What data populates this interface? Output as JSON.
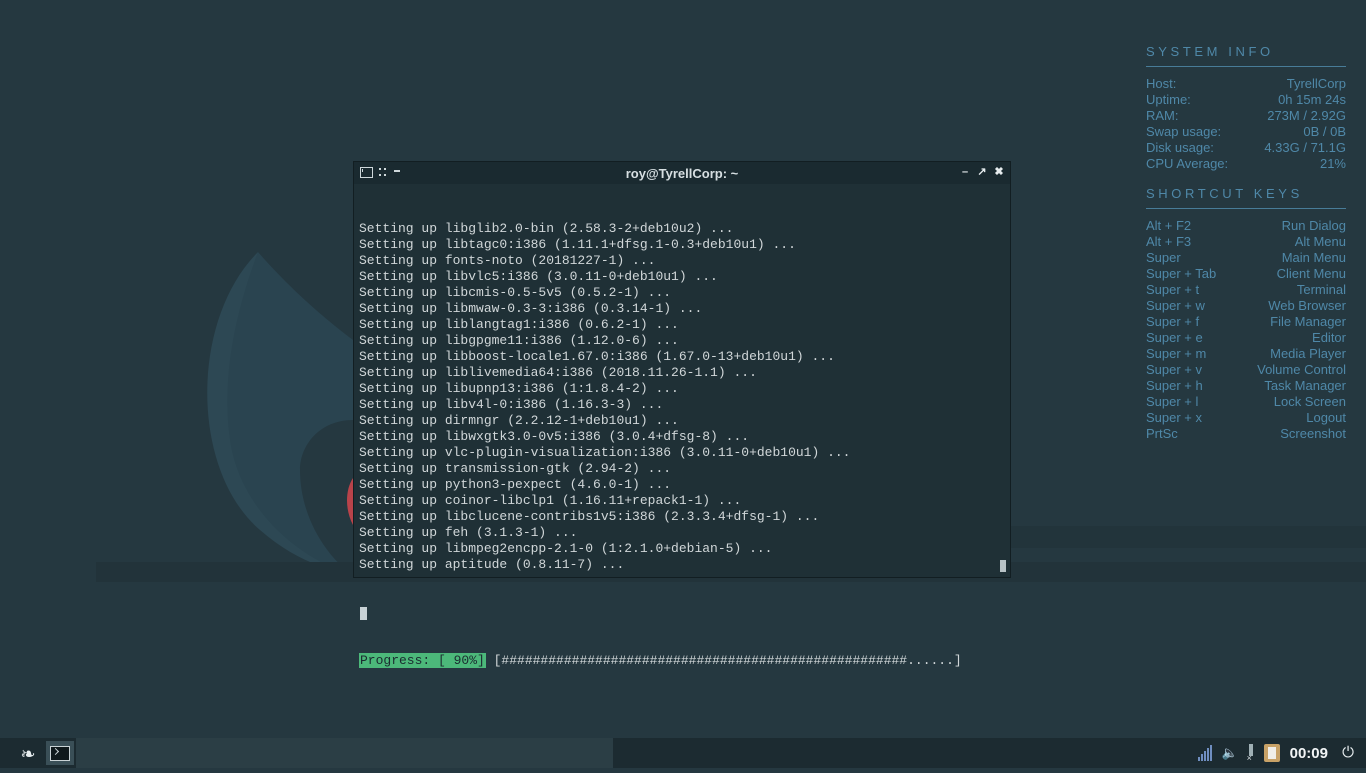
{
  "conky": {
    "system_title": "SYSTEM INFO",
    "system_rows": [
      {
        "label": "Host:",
        "value": "TyrellCorp"
      },
      {
        "label": "Uptime:",
        "value": "0h 15m 24s"
      },
      {
        "label": "RAM:",
        "value": "273M / 2.92G"
      },
      {
        "label": "Swap usage:",
        "value": "0B / 0B"
      },
      {
        "label": "Disk usage:",
        "value": "4.33G / 71.1G"
      },
      {
        "label": "CPU Average:",
        "value": "21%"
      }
    ],
    "shortcut_title": "SHORTCUT KEYS",
    "shortcut_rows": [
      {
        "label": "Alt + F2",
        "value": "Run Dialog"
      },
      {
        "label": "Alt + F3",
        "value": "Alt Menu"
      },
      {
        "label": "Super",
        "value": "Main Menu"
      },
      {
        "label": "Super + Tab",
        "value": "Client Menu"
      },
      {
        "label": "Super + t",
        "value": "Terminal"
      },
      {
        "label": "Super + w",
        "value": "Web Browser"
      },
      {
        "label": "Super + f",
        "value": "File Manager"
      },
      {
        "label": "Super + e",
        "value": "Editor"
      },
      {
        "label": "Super + m",
        "value": "Media Player"
      },
      {
        "label": "Super + v",
        "value": "Volume Control"
      },
      {
        "label": "Super + h",
        "value": "Task Manager"
      },
      {
        "label": "Super + l",
        "value": "Lock Screen"
      },
      {
        "label": "Super + x",
        "value": "Logout"
      },
      {
        "label": "PrtSc",
        "value": "Screenshot"
      }
    ]
  },
  "terminal": {
    "title": "roy@TyrellCorp: ~",
    "lines": [
      "Setting up libglib2.0-bin (2.58.3-2+deb10u2) ...",
      "Setting up libtagc0:i386 (1.11.1+dfsg.1-0.3+deb10u1) ...",
      "Setting up fonts-noto (20181227-1) ...",
      "Setting up libvlc5:i386 (3.0.11-0+deb10u1) ...",
      "Setting up libcmis-0.5-5v5 (0.5.2-1) ...",
      "Setting up libmwaw-0.3-3:i386 (0.3.14-1) ...",
      "Setting up liblangtag1:i386 (0.6.2-1) ...",
      "Setting up libgpgme11:i386 (1.12.0-6) ...",
      "Setting up libboost-locale1.67.0:i386 (1.67.0-13+deb10u1) ...",
      "Setting up liblivemedia64:i386 (2018.11.26-1.1) ...",
      "Setting up libupnp13:i386 (1:1.8.4-2) ...",
      "Setting up libv4l-0:i386 (1.16.3-3) ...",
      "Setting up dirmngr (2.2.12-1+deb10u1) ...",
      "Setting up libwxgtk3.0-0v5:i386 (3.0.4+dfsg-8) ...",
      "Setting up vlc-plugin-visualization:i386 (3.0.11-0+deb10u1) ...",
      "Setting up transmission-gtk (2.94-2) ...",
      "Setting up python3-pexpect (4.6.0-1) ...",
      "Setting up coinor-libclp1 (1.16.11+repack1-1) ...",
      "Setting up libclucene-contribs1v5:i386 (2.3.3.4+dfsg-1) ...",
      "Setting up feh (3.1.3-1) ...",
      "Setting up libmpeg2encpp-2.1-0 (1:2.1.0+debian-5) ...",
      "Setting up aptitude (0.8.11-7) ..."
    ],
    "progress_label": "Progress: [ 90%]",
    "progress_bar": " [####################################################......]",
    "progress_percent": 90
  },
  "taskbar": {
    "clock": "00:09"
  },
  "icons": {
    "launcher": "flame-icon",
    "terminal_task": "terminal-icon",
    "network": "signal-icon",
    "volume": "speaker-icon",
    "removable": "usb-icon",
    "clipboard": "clipboard-icon",
    "power": "power-icon"
  },
  "colors": {
    "desktop": "#253840",
    "accent": "#4f88a8",
    "progress": "#4cb87a"
  }
}
